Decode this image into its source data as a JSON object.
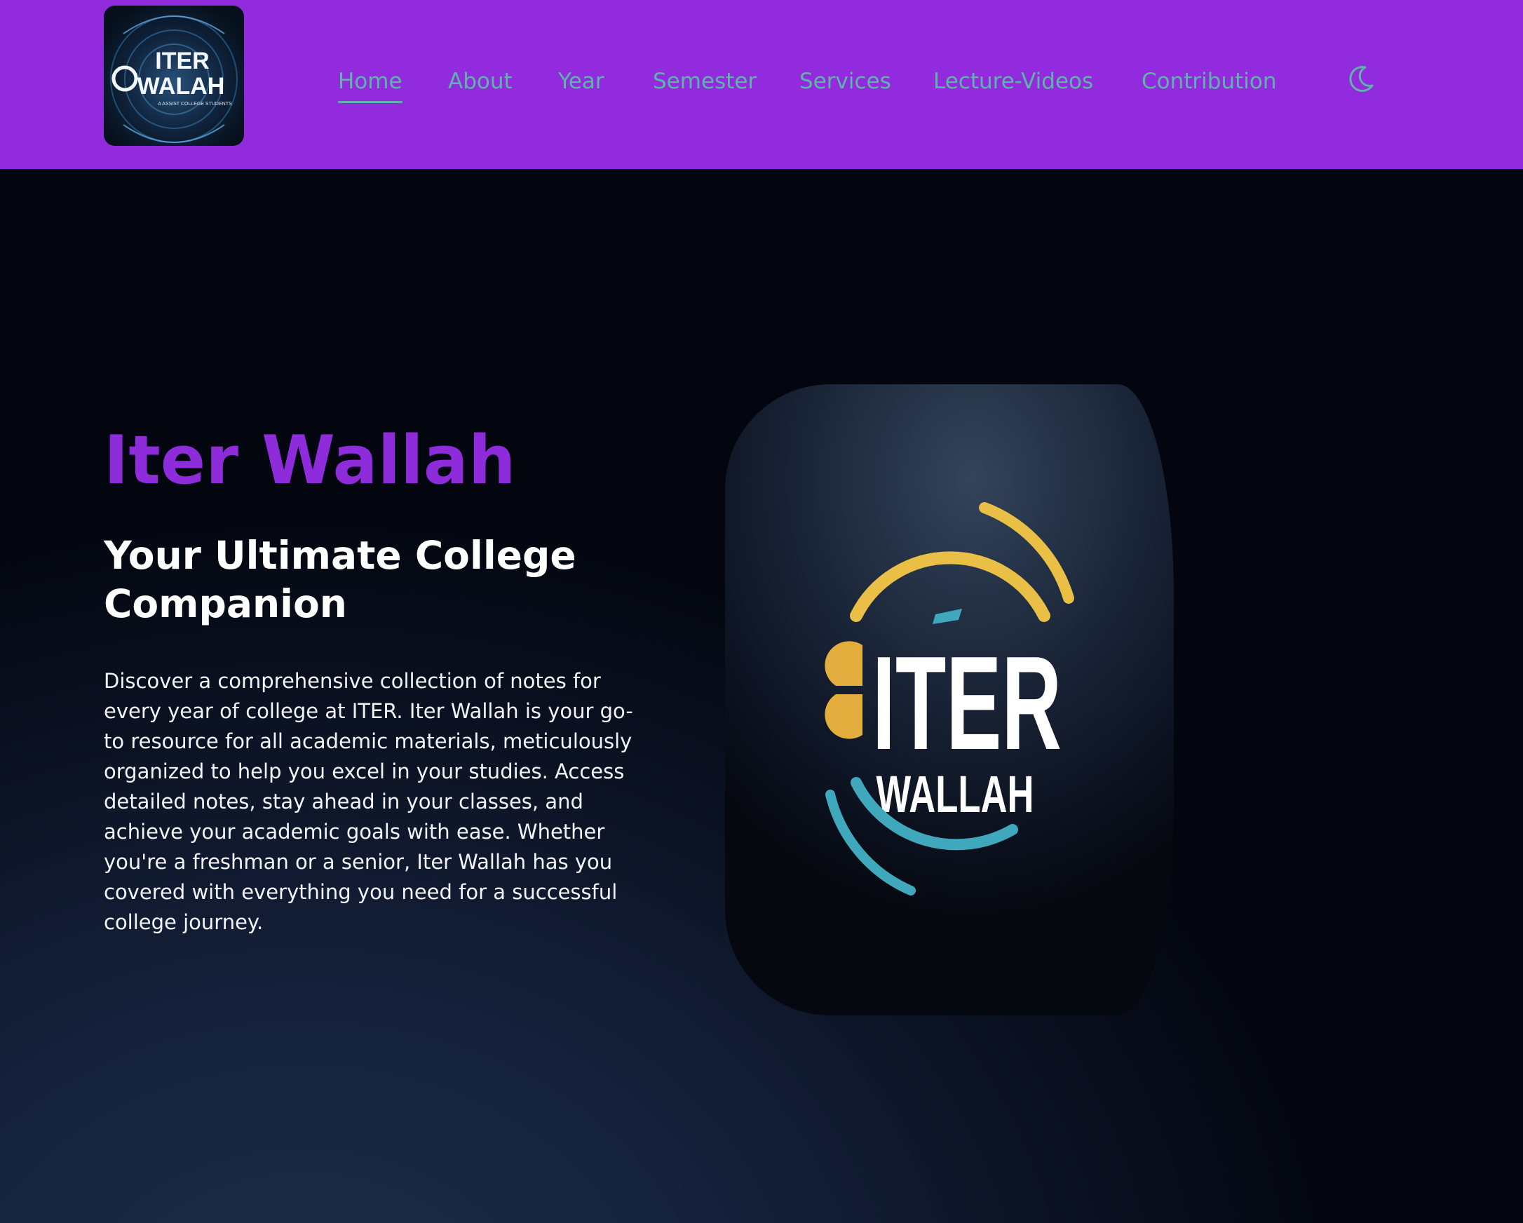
{
  "brand": {
    "logo_alt": "Iter Wallah logo",
    "logo_line1": "ITER",
    "logo_line2": "WALAH",
    "logo_tagline": "A ASSIST COLLEGE STUDENTS"
  },
  "nav": {
    "items": [
      {
        "label": "Home",
        "active": true
      },
      {
        "label": "About",
        "active": false
      },
      {
        "label": "Year",
        "active": false
      },
      {
        "label": "Semester",
        "active": false
      },
      {
        "label": "Services",
        "active": false
      },
      {
        "label": "Lecture-Videos",
        "active": false
      },
      {
        "label": "Contribution",
        "active": false
      }
    ],
    "theme_toggle_icon": "moon-icon"
  },
  "hero": {
    "title": "Iter Wallah",
    "subtitle": "Your Ultimate College Companion",
    "description": "Discover a comprehensive collection of notes for every year of college at ITER. Iter Wallah is your go-to resource for all academic materials, meticulously organized to help you excel in your studies. Access detailed notes, stay ahead in your classes, and achieve your academic goals with ease. Whether you're a freshman or a senior, Iter Wallah has you covered with everything you need for a successful college journey.",
    "image_text_top": "ITER",
    "image_text_bottom": "WALLAH"
  },
  "colors": {
    "navbar_bg": "#912bdd",
    "nav_link": "#5db4a9",
    "title": "#8e2bdb",
    "text": "#ffffff",
    "logo_yellow": "#e9bf45",
    "logo_teal": "#3fa8bd"
  }
}
